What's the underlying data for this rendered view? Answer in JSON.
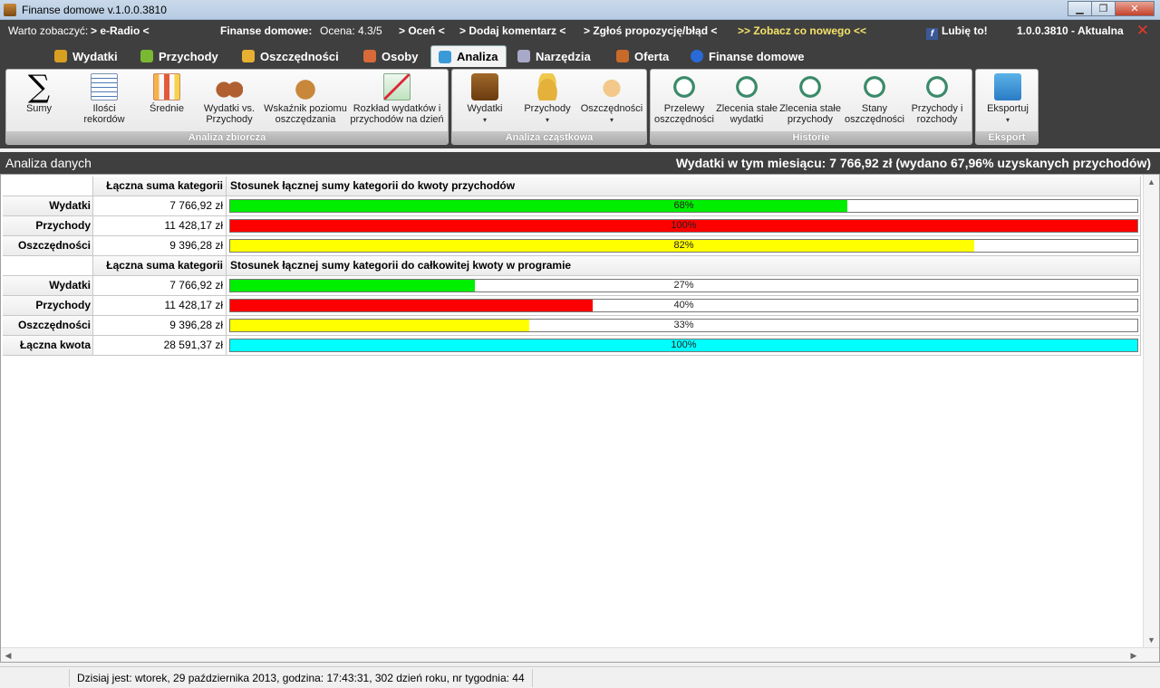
{
  "window": {
    "title": "Finanse domowe v.1.0.0.3810"
  },
  "infobar": {
    "see_label": "Warto zobaczyć:",
    "radio": "> e-Radio <",
    "app_name": "Finanse domowe:",
    "rating": "Ocena: 4.3/5",
    "rate": "> Oceń <",
    "comment": "> Dodaj komentarz <",
    "report": "> Zgłoś propozycję/błąd <",
    "whats_new": ">> Zobacz co nowego <<",
    "like": "Lubię to!",
    "version": "1.0.0.3810 - Aktualna"
  },
  "tabs": [
    {
      "label": "Wydatki",
      "color": "#d8a020"
    },
    {
      "label": "Przychody",
      "color": "#7ab832"
    },
    {
      "label": "Oszczędności",
      "color": "#e8b030"
    },
    {
      "label": "Osoby",
      "color": "#d86a3a"
    },
    {
      "label": "Analiza",
      "color": "#3a9ad8",
      "active": true
    },
    {
      "label": "Narzędzia",
      "color": "#a8a8c8"
    },
    {
      "label": "Oferta",
      "color": "#c86a2a"
    },
    {
      "label": "Finanse domowe",
      "color": "#2a6ad8"
    }
  ],
  "ribbon": {
    "groups": [
      {
        "label": "Analiza zbiorcza"
      },
      {
        "label": "Analiza cząstkowa"
      },
      {
        "label": "Historie"
      },
      {
        "label": "Eksport"
      }
    ],
    "buttons": {
      "sumy": "Sumy",
      "ilosci_1": "Ilości",
      "ilosci_2": "rekordów",
      "srednie": "Średnie",
      "wvp_1": "Wydatki vs.",
      "wvp_2": "Przychody",
      "wsk_1": "Wskaźnik poziomu",
      "wsk_2": "oszczędzania",
      "rozk_1": "Rozkład wydatków i",
      "rozk_2": "przychodów na dzień",
      "wydatki": "Wydatki",
      "przychody": "Przychody",
      "oszczednosci": "Oszczędności",
      "przel_1": "Przelewy",
      "przel_2": "oszczędności",
      "zlw_1": "Zlecenia stałe",
      "zlw_2": "wydatki",
      "zlp_1": "Zlecenia stałe",
      "zlp_2": "przychody",
      "stany_1": "Stany",
      "stany_2": "oszczędności",
      "pir_1": "Przychody i",
      "pir_2": "rozchody",
      "eksportuj": "Eksportuj",
      "dropdown_glyph": "▾"
    }
  },
  "section": {
    "title": "Analiza danych",
    "summary": "Wydatki w tym miesiącu: 7 766,92 zł (wydano 67,96% uzyskanych przychodów)"
  },
  "table1": {
    "col_sum": "Łączna suma kategorii",
    "col_ratio": "Stosunek łącznej sumy kategorii do kwoty przychodów",
    "rows": [
      {
        "label": "Wydatki",
        "value": "7 766,92 zł",
        "pct": "68%",
        "fraction": 0.68,
        "color": "#00ee00"
      },
      {
        "label": "Przychody",
        "value": "11 428,17 zł",
        "pct": "100%",
        "fraction": 1.0,
        "color": "#ff0000"
      },
      {
        "label": "Oszczędności",
        "value": "9 396,28 zł",
        "pct": "82%",
        "fraction": 0.82,
        "color": "#ffff00"
      }
    ]
  },
  "table2": {
    "col_sum": "Łączna suma kategorii",
    "col_ratio": "Stosunek łącznej sumy kategorii do całkowitej kwoty w programie",
    "rows": [
      {
        "label": "Wydatki",
        "value": "7 766,92 zł",
        "pct": "27%",
        "fraction": 0.27,
        "color": "#00ee00"
      },
      {
        "label": "Przychody",
        "value": "11 428,17 zł",
        "pct": "40%",
        "fraction": 0.4,
        "color": "#ff0000"
      },
      {
        "label": "Oszczędności",
        "value": "9 396,28 zł",
        "pct": "33%",
        "fraction": 0.33,
        "color": "#ffff00"
      },
      {
        "label": "Łączna kwota",
        "value": "28 591,37 zł",
        "pct": "100%",
        "fraction": 1.0,
        "color": "#00ffff"
      }
    ]
  },
  "status": {
    "text": "Dzisiaj jest: wtorek,  29 października 2013, godzina: 17:43:31, 302 dzień roku, nr tygodnia: 44"
  }
}
